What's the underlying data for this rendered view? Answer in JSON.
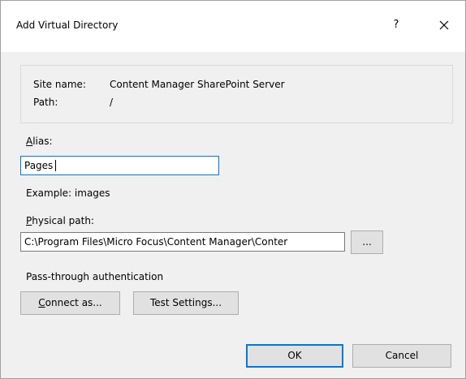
{
  "window": {
    "title": "Add Virtual Directory",
    "help_label": "?"
  },
  "info": {
    "site_name_label": "Site name:",
    "site_name_value": "Content Manager SharePoint Server",
    "path_label": "Path:",
    "path_value": "/"
  },
  "alias": {
    "label_prefix": "A",
    "label_rest": "lias:",
    "value": "Pages",
    "example": "Example: images"
  },
  "physical_path": {
    "label_prefix": "P",
    "label_rest": "hysical path:",
    "value": "C:\\Program Files\\Micro Focus\\Content Manager\\Conter",
    "browse_label": "..."
  },
  "authentication": {
    "heading": "Pass-through authentication",
    "connect_prefix": "C",
    "connect_rest": "onnect as...",
    "test_settings_label": "Test Settings..."
  },
  "footer": {
    "ok_label": "OK",
    "cancel_label": "Cancel"
  },
  "colors": {
    "focus_border": "#0078d7",
    "dialog_background": "#f0f0f0",
    "button_face": "#e1e1e1"
  }
}
